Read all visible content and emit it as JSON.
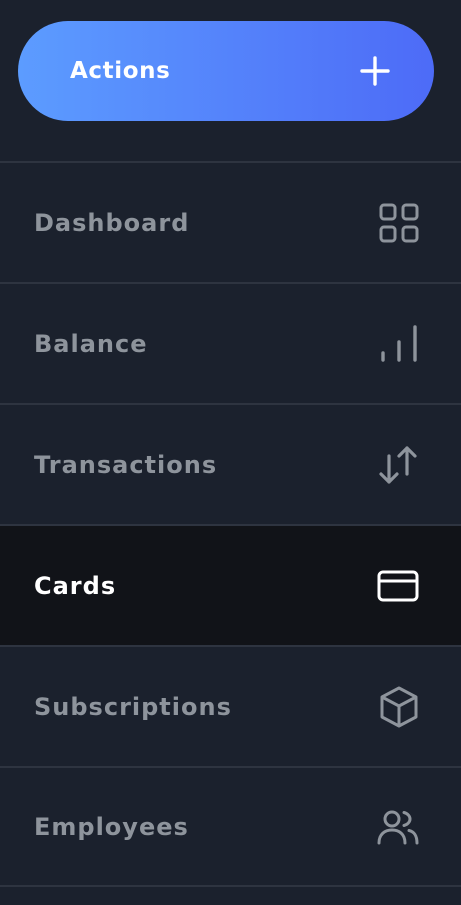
{
  "actions": {
    "label": "Actions",
    "icon": "plus-icon"
  },
  "nav": {
    "active_index": 3,
    "items": [
      {
        "label": "Dashboard",
        "icon": "grid-icon"
      },
      {
        "label": "Balance",
        "icon": "bar-chart-icon"
      },
      {
        "label": "Transactions",
        "icon": "arrows-up-down-icon"
      },
      {
        "label": "Cards",
        "icon": "credit-card-icon"
      },
      {
        "label": "Subscriptions",
        "icon": "box-icon"
      },
      {
        "label": "Employees",
        "icon": "users-icon"
      }
    ]
  },
  "colors": {
    "background": "#1b212d",
    "active_background": "#111318",
    "divider": "#2e3440",
    "label": "#8e949c",
    "active_label": "#ffffff",
    "accent_start": "#5c9cff",
    "accent_end": "#4d6bf7"
  }
}
